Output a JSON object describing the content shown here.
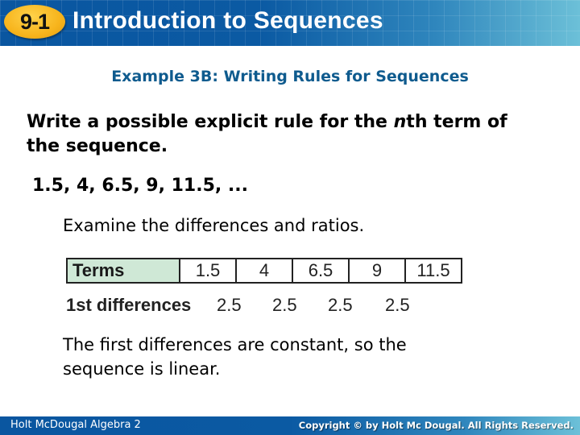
{
  "header": {
    "lesson_badge": "9-1",
    "title": "Introduction to Sequences",
    "colors": {
      "bar": "#0a56a0",
      "badge": "#f7b41c"
    }
  },
  "example_title": "Example 3B: Writing Rules for Sequences",
  "prompt": {
    "before_italic": "Write a possible explicit rule for the ",
    "italic": "n",
    "after_italic": "th term of the sequence."
  },
  "sequence": "1.5, 4, 6.5, 9, 11.5, ...",
  "examine_text": "Examine the differences and ratios.",
  "table": {
    "terms_label": "Terms",
    "terms": [
      "1.5",
      "4",
      "6.5",
      "9",
      "11.5"
    ],
    "diff_label": "1st differences",
    "differences": [
      "2.5",
      "2.5",
      "2.5",
      "2.5"
    ]
  },
  "conclusion": "The first differences are constant, so the sequence is linear.",
  "footer": {
    "left": "Holt McDougal Algebra 2",
    "right": "Copyright © by Holt Mc Dougal. All Rights Reserved."
  }
}
